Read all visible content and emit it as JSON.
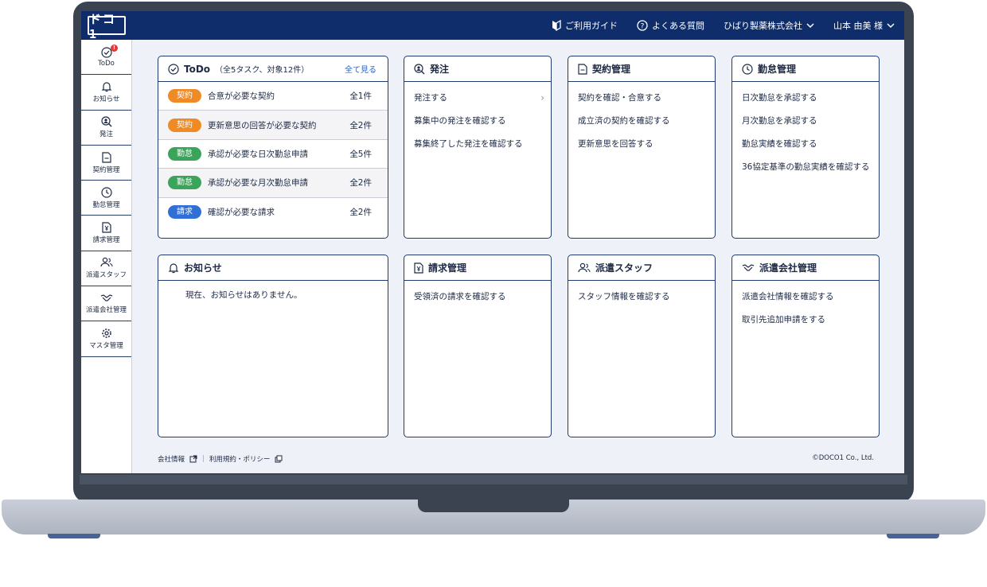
{
  "brand": {
    "logo_text": "ドコ1"
  },
  "topnav": {
    "guide": "ご利用ガイド",
    "faq": "よくある質問",
    "company": "ひばり製薬株式会社",
    "user": "山本 由美 様"
  },
  "sidebar": {
    "items": [
      {
        "label": "ToDo",
        "icon": "check-circle-icon",
        "badge": "!"
      },
      {
        "label": "お知らせ",
        "icon": "bell-icon"
      },
      {
        "label": "発注",
        "icon": "person-search-icon"
      },
      {
        "label": "契約管理",
        "icon": "document-icon"
      },
      {
        "label": "勤怠管理",
        "icon": "clock-icon"
      },
      {
        "label": "請求管理",
        "icon": "yen-document-icon"
      },
      {
        "label": "派遣スタッフ",
        "icon": "people-icon"
      },
      {
        "label": "派遣会社管理",
        "icon": "handshake-icon"
      },
      {
        "label": "マスタ管理",
        "icon": "gear-icon"
      }
    ]
  },
  "todo": {
    "title": "ToDo",
    "count": "（全5タスク、対象12件）",
    "see_all": "全て見る",
    "rows": [
      {
        "tag": "契約",
        "text": "合意が必要な契約",
        "total": "全1件"
      },
      {
        "tag": "契約",
        "text": "更新意思の回答が必要な契約",
        "total": "全2件"
      },
      {
        "tag": "勤怠",
        "text": "承認が必要な日次勤怠申請",
        "total": "全5件"
      },
      {
        "tag": "勤怠",
        "text": "承認が必要な月次勤怠申請",
        "total": "全2件"
      },
      {
        "tag": "請求",
        "text": "確認が必要な請求",
        "total": "全2件"
      }
    ]
  },
  "order": {
    "title": "発注",
    "links": [
      "発注する",
      "募集中の発注を確認する",
      "募集終了した発注を確認する"
    ]
  },
  "contract": {
    "title": "契約管理",
    "links": [
      "契約を確認・合意する",
      "成立済の契約を確認する",
      "更新意思を回答する"
    ]
  },
  "attendance": {
    "title": "勤怠管理",
    "links": [
      "日次勤怠を承認する",
      "月次勤怠を承認する",
      "勤怠実績を確認する",
      "36協定基準の勤怠実績を確認する"
    ]
  },
  "notice": {
    "title": "お知らせ",
    "text": "現在、お知らせはありません。"
  },
  "billing": {
    "title": "請求管理",
    "links": [
      "受領済の請求を確認する"
    ]
  },
  "staff": {
    "title": "派遣スタッフ",
    "links": [
      "スタッフ情報を確認する"
    ]
  },
  "agency": {
    "title": "派遣会社管理",
    "links": [
      "派遣会社情報を確認する",
      "取引先追加申請をする"
    ]
  },
  "footer": {
    "company_info": "会社情報",
    "terms": "利用規約・ポリシー",
    "copyright": "©DOCO1 Co., Ltd."
  },
  "colors": {
    "navy": "#0f2d6a",
    "contract_tag": "#f08a24",
    "attendance_tag": "#3aa55a",
    "billing_tag": "#2f6fd6"
  }
}
